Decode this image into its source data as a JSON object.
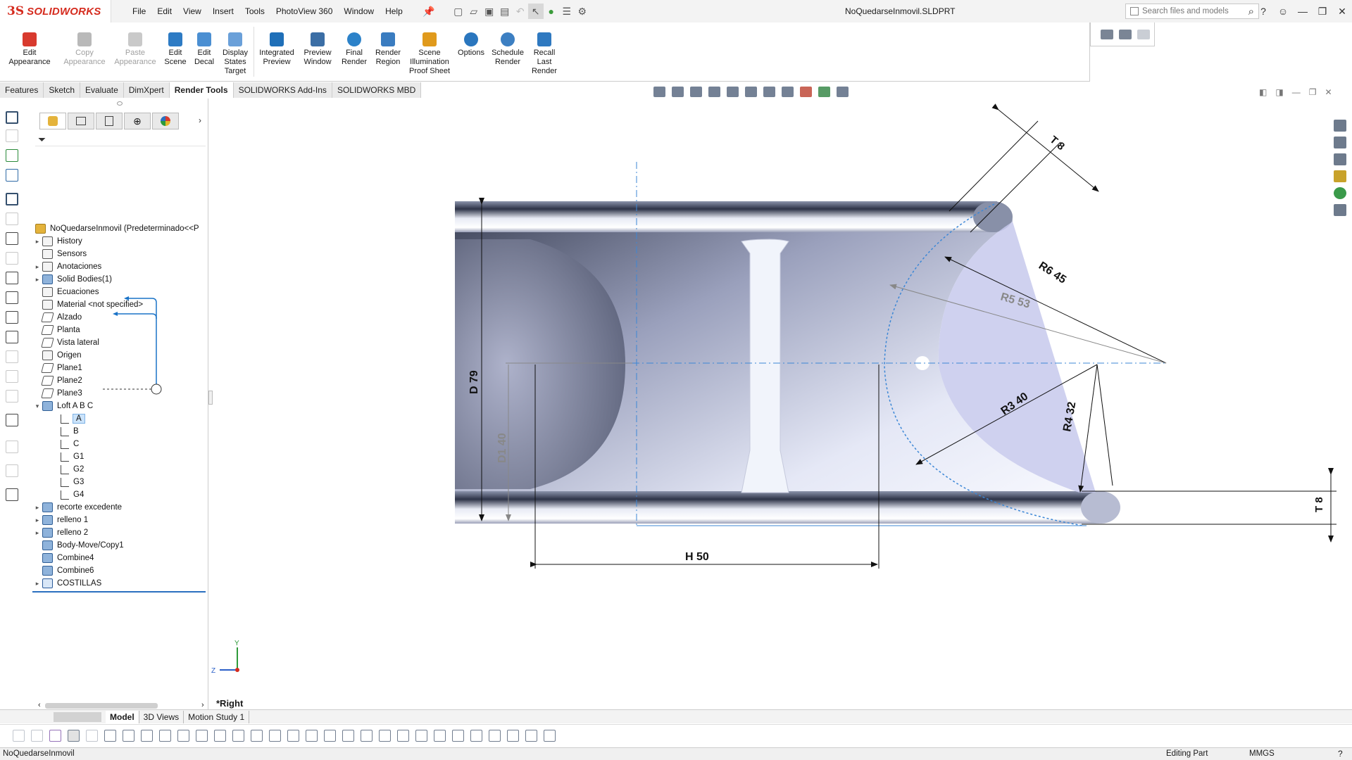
{
  "app": {
    "brand": "SOLIDWORKS",
    "brand_prefix": "3S"
  },
  "menu": [
    "File",
    "Edit",
    "View",
    "Insert",
    "Tools",
    "PhotoView 360",
    "Window",
    "Help"
  ],
  "document_title": "NoQuedarseInmovil.SLDPRT",
  "search": {
    "placeholder": "Search files and models"
  },
  "ribbon": {
    "buttons": [
      {
        "label": "Edit Appearance",
        "enabled": true,
        "color": "#d83a2e"
      },
      {
        "label": "Copy Appearance",
        "enabled": false,
        "color": "#b9b9b9"
      },
      {
        "label": "Paste Appearance",
        "enabled": false,
        "color": "#c9c9c9"
      },
      {
        "label": "Edit Scene",
        "enabled": true,
        "color": "#2d7bc4"
      },
      {
        "label": "Edit Decal",
        "enabled": true,
        "color": "#4b8fd2"
      },
      {
        "label": "Display States Target",
        "enabled": true,
        "color": "#6aa0d9"
      },
      {
        "label": "Integrated Preview",
        "enabled": true,
        "color": "#1f6fb8"
      },
      {
        "label": "Preview Window",
        "enabled": true,
        "color": "#3b6ea5"
      },
      {
        "label": "Final Render",
        "enabled": true,
        "color": "#2c82c9"
      },
      {
        "label": "Render Region",
        "enabled": true,
        "color": "#3a7cc0"
      },
      {
        "label": "Scene Illumination Proof Sheet",
        "enabled": true,
        "color": "#e09a1c"
      },
      {
        "label": "Options",
        "enabled": true,
        "color": "#2a76be"
      },
      {
        "label": "Schedule Render",
        "enabled": true,
        "color": "#3c7fc2"
      },
      {
        "label": "Recall Last Render",
        "enabled": true,
        "color": "#2f79c0"
      }
    ]
  },
  "command_tabs": [
    "Features",
    "Sketch",
    "Evaluate",
    "DimXpert",
    "Render Tools",
    "SOLIDWORKS Add-Ins",
    "SOLIDWORKS MBD"
  ],
  "active_command_tab": "Render Tools",
  "tree": {
    "root": "NoQuedarseInmovil  (Predeterminado<<P",
    "items": [
      {
        "label": "History",
        "icon": "history-icon"
      },
      {
        "label": "Sensors",
        "icon": "sensors-icon"
      },
      {
        "label": "Anotaciones",
        "icon": "annotations-icon"
      },
      {
        "label": "Solid Bodies(1)",
        "icon": "solid-bodies-icon"
      },
      {
        "label": "Ecuaciones",
        "icon": "equations-icon"
      },
      {
        "label": "Material <not specified>",
        "icon": "material-icon"
      },
      {
        "label": "Alzado",
        "icon": "plane-icon"
      },
      {
        "label": "Planta",
        "icon": "plane-icon"
      },
      {
        "label": "Vista lateral",
        "icon": "plane-icon"
      },
      {
        "label": "Origen",
        "icon": "origin-icon"
      },
      {
        "label": "Plane1",
        "icon": "plane-icon"
      },
      {
        "label": "Plane2",
        "icon": "plane-icon"
      },
      {
        "label": "Plane3",
        "icon": "plane-icon"
      },
      {
        "label": "Loft A B C",
        "icon": "loft-icon"
      },
      {
        "label": "A",
        "icon": "sketch-icon"
      },
      {
        "label": "B",
        "icon": "sketch-icon"
      },
      {
        "label": "C",
        "icon": "sketch-icon"
      },
      {
        "label": "G1",
        "icon": "sketch-icon"
      },
      {
        "label": "G2",
        "icon": "sketch-icon"
      },
      {
        "label": "G3",
        "icon": "sketch-icon"
      },
      {
        "label": "G4",
        "icon": "sketch-icon"
      },
      {
        "label": "recorte excedente",
        "icon": "cut-icon"
      },
      {
        "label": "relleno 1",
        "icon": "fill-icon"
      },
      {
        "label": "relleno 2",
        "icon": "fill-icon"
      },
      {
        "label": "Body-Move/Copy1",
        "icon": "move-copy-icon"
      },
      {
        "label": "Combine4",
        "icon": "combine-icon"
      },
      {
        "label": "Combine6",
        "icon": "combine-icon"
      },
      {
        "label": "COSTILLAS",
        "icon": "folder-icon"
      }
    ]
  },
  "dimensions": {
    "t_top": "T 8",
    "r6": "R6 45",
    "r5": "R5 53",
    "d79": "D 79",
    "r3": "R3 40",
    "r4": "R4 32",
    "d1": "D1 40",
    "t_right": "T 8",
    "h50": "H 50"
  },
  "triad": {
    "y": "Y",
    "z": "Z"
  },
  "view_name": "*Right",
  "bottom_tabs": [
    "Model",
    "3D Views",
    "Motion Study 1"
  ],
  "active_bottom_tab": "Model",
  "status": {
    "file": "NoQuedarseInmovil",
    "mode": "Editing Part",
    "units": "MMGS"
  },
  "colors": {
    "accent": "#1a73c7",
    "brand": "#d52b1e",
    "dim_line": "#111111"
  }
}
